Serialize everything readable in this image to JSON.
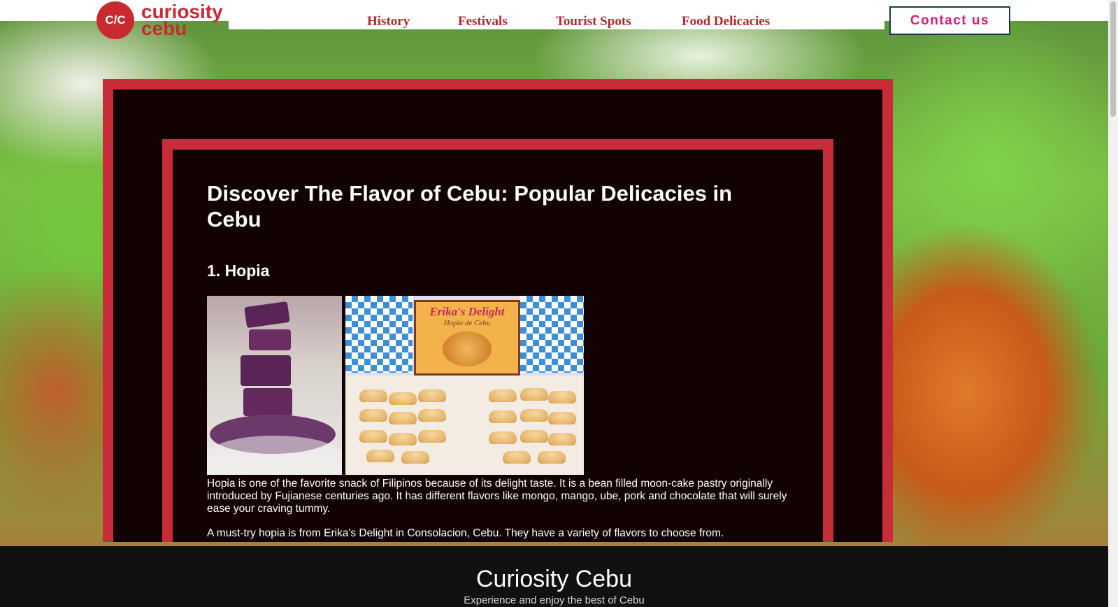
{
  "logo": {
    "badge": "C/C",
    "line1": "curiosity",
    "line2": "cebu"
  },
  "nav": {
    "items": [
      {
        "label": "History"
      },
      {
        "label": "Festivals"
      },
      {
        "label": "Tourist Spots"
      },
      {
        "label": "Food Delicacies"
      }
    ],
    "contact_label": "Contact us"
  },
  "article": {
    "title": "Discover The Flavor of Cebu: Popular Delicacies in Cebu",
    "section_title": "1. Hopia",
    "photo2_box_title": "Erika's Delight",
    "photo2_box_subtitle": "Hopia de Cebu",
    "paragraphs": [
      "Hopia is one of the favorite snack of Filipinos because of its delight taste. It is a bean filled moon-cake pastry originally introduced by Fujianese centuries ago. It has different flavors like mongo, mango, ube, pork and chocolate that will surely ease your craving tummy.",
      "A must-try hopia is from Erika's Delight in Consolacion, Cebu. They have a variety of flavors to choose from."
    ]
  },
  "footer": {
    "title": "Curiosity Cebu",
    "subtitle": "Experience and enjoy the best of Cebu"
  },
  "colors": {
    "brand_red": "#c92a30",
    "card_border": "#c72d38",
    "card_bg": "#120202",
    "contact_text": "#d81b7a",
    "footer_bg": "#111111"
  }
}
